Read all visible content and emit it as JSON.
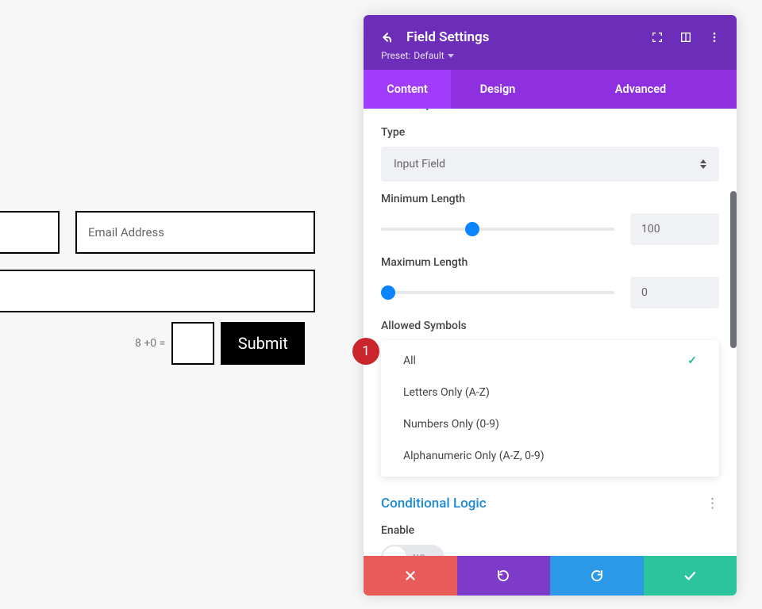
{
  "form": {
    "email_placeholder": "Email Address",
    "captcha_label": "8 +0 =",
    "submit_label": "Submit"
  },
  "panel": {
    "title": "Field Settings",
    "preset_prefix": "Preset:",
    "preset_value": "Default",
    "tabs": {
      "content": "Content",
      "design": "Design",
      "advanced": "Advanced"
    },
    "section_field_options": "Field Options",
    "type_label": "Type",
    "type_value": "Input Field",
    "min_label": "Minimum Length",
    "min_value": "100",
    "max_label": "Maximum Length",
    "max_value": "0",
    "symbols_label": "Allowed Symbols",
    "symbols_options": {
      "all": "All",
      "letters": "Letters Only (A-Z)",
      "numbers": "Numbers Only (0-9)",
      "alnum": "Alphanumeric Only (A-Z, 0-9)"
    },
    "conditional_title": "Conditional Logic",
    "enable_label": "Enable",
    "toggle_value": "NO"
  },
  "badge": {
    "number": "1"
  }
}
